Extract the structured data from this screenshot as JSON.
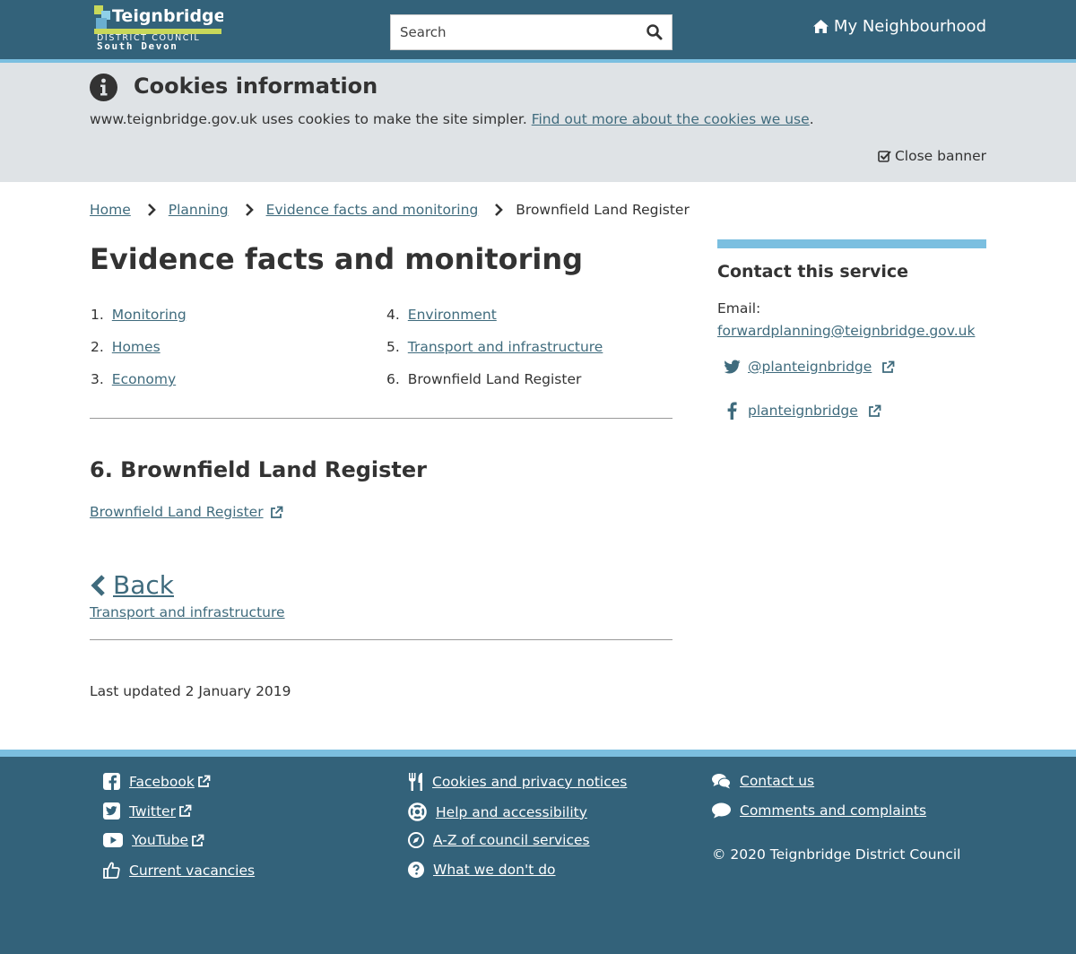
{
  "header": {
    "logo": {
      "name": "Teignbridge",
      "line1": "DISTRICT COUNCIL",
      "line2": "South Devon"
    },
    "search_placeholder": "Search",
    "my_neighbourhood": "My Neighbourhood"
  },
  "cookie_banner": {
    "title": "Cookies information",
    "text": "www.teignbridge.gov.uk uses cookies to make the site simpler.",
    "link": "Find out more about the cookies we use",
    "end": ".",
    "close": "Close banner"
  },
  "breadcrumb": [
    "Home",
    "Planning",
    "Evidence facts and monitoring",
    "Brownfield Land Register"
  ],
  "main": {
    "title": "Evidence facts and monitoring",
    "toc": [
      {
        "num": "1.",
        "label": "Monitoring"
      },
      {
        "num": "2.",
        "label": "Homes"
      },
      {
        "num": "3.",
        "label": "Economy"
      },
      {
        "num": "4.",
        "label": "Environment"
      },
      {
        "num": "5.",
        "label": "Transport and infrastructure"
      },
      {
        "num": "6.",
        "label": "Brownfield Land Register"
      }
    ],
    "section_title": "6. Brownfield Land Register",
    "section_link": "Brownfield Land Register",
    "back": "Back",
    "back_sub": "Transport and infrastructure",
    "updated": "Last updated 2 January 2019"
  },
  "sidebar": {
    "title": "Contact this service",
    "email_label": "Email:",
    "email": "forwardplanning@teignbridge.gov.uk",
    "twitter": "@planteignbridge",
    "facebook": "planteignbridge"
  },
  "footer": {
    "col1": [
      "Facebook",
      "Twitter",
      "YouTube",
      "Current vacancies"
    ],
    "col2": [
      "Cookies and privacy notices",
      "Help and accessibility",
      "A-Z of council services",
      "What we don't do"
    ],
    "col3": [
      "Contact us",
      "Comments and complaints"
    ],
    "copyright": "© 2020 Teignbridge District Council"
  },
  "colors": {
    "brand": "#33627a",
    "accent": "#7bbfe0",
    "link": "#3f6b7d",
    "banner": "#dfe3e6"
  }
}
